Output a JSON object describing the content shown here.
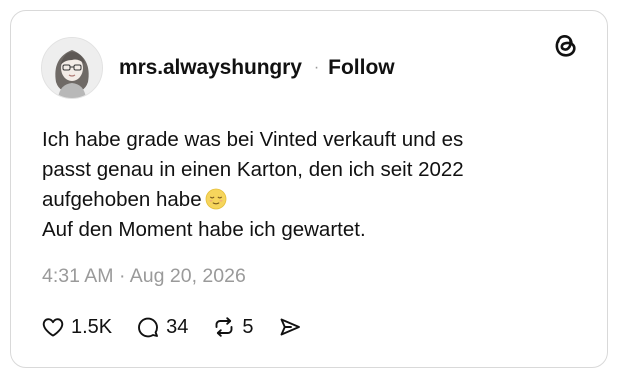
{
  "post": {
    "username": "mrs.alwayshungry",
    "separator": "·",
    "follow_label": "Follow",
    "text_lines": [
      "Ich habe grade was bei Vinted verkauft und es",
      "passt genau in einen Karton, den ich seit 2022",
      "aufgehoben habe",
      "Auf den Moment habe ich gewartet."
    ],
    "emoji": "relieved-face-emoji",
    "timestamp": "4:31 AM · Aug 20, 2026",
    "logo_icon": "threads-logo-icon"
  },
  "actions": {
    "likes": "1.5K",
    "replies": "34",
    "reposts": "5",
    "like_icon": "heart-icon",
    "reply_icon": "comment-bubble-icon",
    "repost_icon": "repost-icon",
    "share_icon": "send-icon"
  },
  "colors": {
    "text": "#111111",
    "muted": "#9a9a9a",
    "border": "#d9d9d9"
  }
}
